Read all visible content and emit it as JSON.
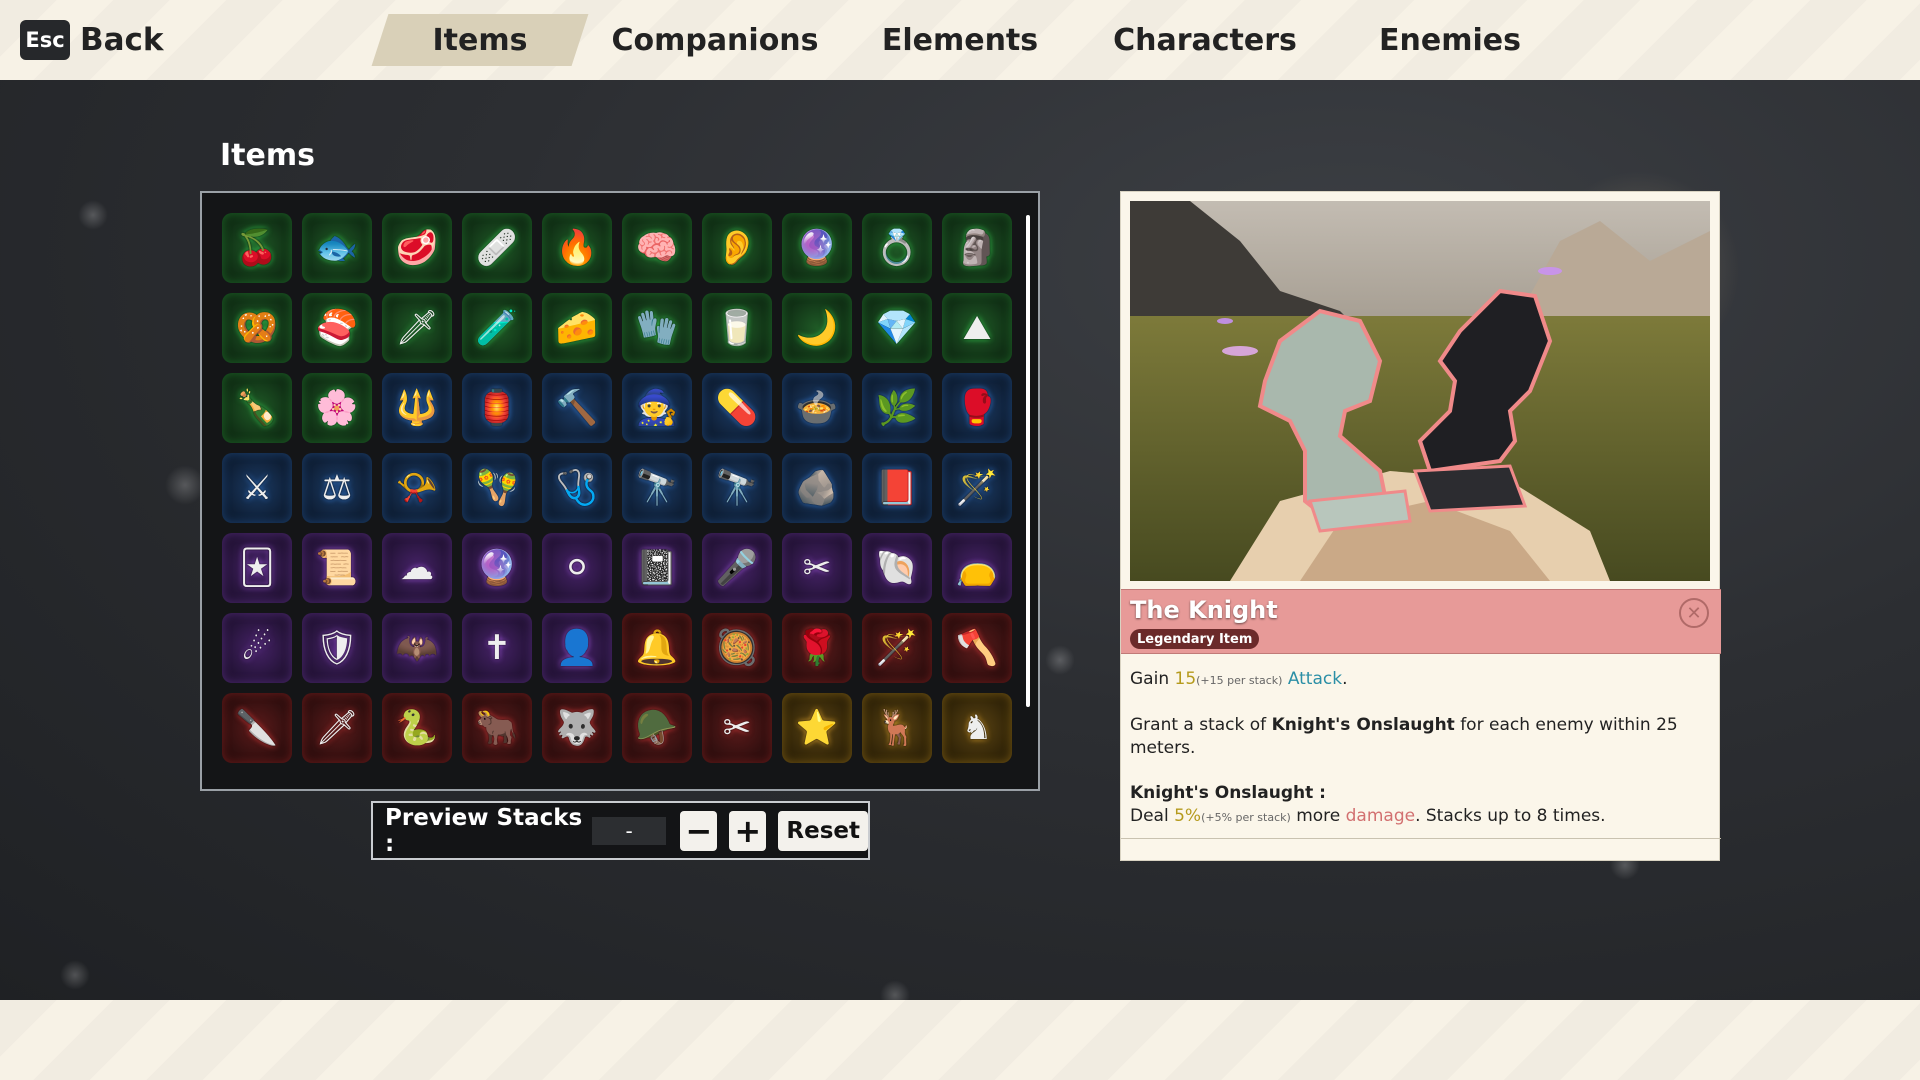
{
  "nav": {
    "back_key": "Esc",
    "back_label": "Back",
    "tabs": [
      {
        "label": "Items",
        "active": true
      },
      {
        "label": "Companions",
        "active": false
      },
      {
        "label": "Elements",
        "active": false
      },
      {
        "label": "Characters",
        "active": false
      },
      {
        "label": "Enemies",
        "active": false
      }
    ]
  },
  "items_section": {
    "title": "Items",
    "grid": [
      [
        "green",
        "cherries-icon"
      ],
      [
        "green",
        "fish-icon"
      ],
      [
        "green",
        "steak-icon"
      ],
      [
        "green",
        "bandage-icon"
      ],
      [
        "green",
        "flame-icon"
      ],
      [
        "green",
        "brain-icon"
      ],
      [
        "green",
        "ear-icon"
      ],
      [
        "green",
        "snow-globe-icon"
      ],
      [
        "green",
        "ring-icon"
      ],
      [
        "green",
        "idol-icon"
      ],
      [
        "green",
        "pretzel-icon"
      ],
      [
        "green",
        "sushi-icon"
      ],
      [
        "green",
        "blade-icon"
      ],
      [
        "green",
        "potion-icon"
      ],
      [
        "green",
        "cheese-icon"
      ],
      [
        "green",
        "glove-icon"
      ],
      [
        "green",
        "cup-icon"
      ],
      [
        "green",
        "moon-icon"
      ],
      [
        "green",
        "crystal-icon"
      ],
      [
        "green",
        "sand-pile-icon"
      ],
      [
        "green",
        "bottle-icon"
      ],
      [
        "green",
        "lotus-icon"
      ],
      [
        "blue",
        "trident-icon"
      ],
      [
        "blue",
        "lantern-icon"
      ],
      [
        "blue",
        "hammer-icon"
      ],
      [
        "blue",
        "robed-figure-icon"
      ],
      [
        "blue",
        "capsule-icon"
      ],
      [
        "blue",
        "cooking-pot-icon"
      ],
      [
        "blue",
        "leaf-icon"
      ],
      [
        "blue",
        "gauntlet-icon"
      ],
      [
        "blue",
        "crossed-swords-icon"
      ],
      [
        "blue",
        "scales-icon"
      ],
      [
        "blue",
        "horn-icon"
      ],
      [
        "blue",
        "maracas-icon"
      ],
      [
        "blue",
        "medkit-icon"
      ],
      [
        "blue",
        "binoculars-icon"
      ],
      [
        "blue",
        "telescope-icon"
      ],
      [
        "blue",
        "stone-tablet-icon"
      ],
      [
        "blue",
        "book-icon"
      ],
      [
        "blue",
        "staff-icon"
      ],
      [
        "purple",
        "jester-icon"
      ],
      [
        "purple",
        "scroll-icon"
      ],
      [
        "purple",
        "cloud-icon"
      ],
      [
        "purple",
        "crystal-ball-icon"
      ],
      [
        "purple",
        "pearl-icon"
      ],
      [
        "purple",
        "spellbook-icon"
      ],
      [
        "purple",
        "microphone-icon"
      ],
      [
        "purple",
        "crossed-blades-icon"
      ],
      [
        "purple",
        "shell-icon"
      ],
      [
        "purple",
        "pouch-icon"
      ],
      [
        "purple",
        "comet-icon"
      ],
      [
        "purple",
        "shield-icon"
      ],
      [
        "purple",
        "bat-icon"
      ],
      [
        "purple",
        "cross-icon"
      ],
      [
        "purple",
        "shadow-icon"
      ],
      [
        "red",
        "bell-icon"
      ],
      [
        "red",
        "cauldron-icon"
      ],
      [
        "red",
        "rose-icon"
      ],
      [
        "red",
        "magic-wand-icon"
      ],
      [
        "red",
        "axe-icon"
      ],
      [
        "red",
        "dagger-icon"
      ],
      [
        "red",
        "sword-icon"
      ],
      [
        "red",
        "serpent-icon"
      ],
      [
        "red",
        "horns-icon"
      ],
      [
        "red",
        "wolf-head-icon"
      ],
      [
        "red",
        "winged-helm-icon"
      ],
      [
        "red",
        "scissors-icon"
      ],
      [
        "gold",
        "golden-star-icon"
      ],
      [
        "gold",
        "golden-horns-icon"
      ],
      [
        "gold",
        "golden-knight-icon"
      ]
    ]
  },
  "preview": {
    "label": "Preview Stacks :",
    "value": "-",
    "minus_label": "−",
    "plus_label": "+",
    "reset_label": "Reset"
  },
  "detail": {
    "name": "The Knight",
    "rarity": "Legendary Item",
    "line1": {
      "pre": "Gain ",
      "value": "15",
      "per": "(+15 per stack)",
      "stat": "Attack",
      "post": "."
    },
    "line2": {
      "pre": "Grant a stack of ",
      "bold": "Knight's Onslaught",
      "post": " for each enemy within 25 meters."
    },
    "effect_title": "Knight's Onslaught :",
    "line3": {
      "pre": "Deal ",
      "value": "5%",
      "per": "(+5% per stack)",
      "mid": " more ",
      "stat": "damage",
      "post": ". Stacks up to 8 times."
    }
  },
  "colors": {
    "header_bg": "#f7f2e6",
    "legendary_header": "#e79a98",
    "common": "#3be05a",
    "uncommon": "#3d8cf0",
    "rare": "#b060f0",
    "epic": "#f04040",
    "legendary": "#f0b030"
  }
}
